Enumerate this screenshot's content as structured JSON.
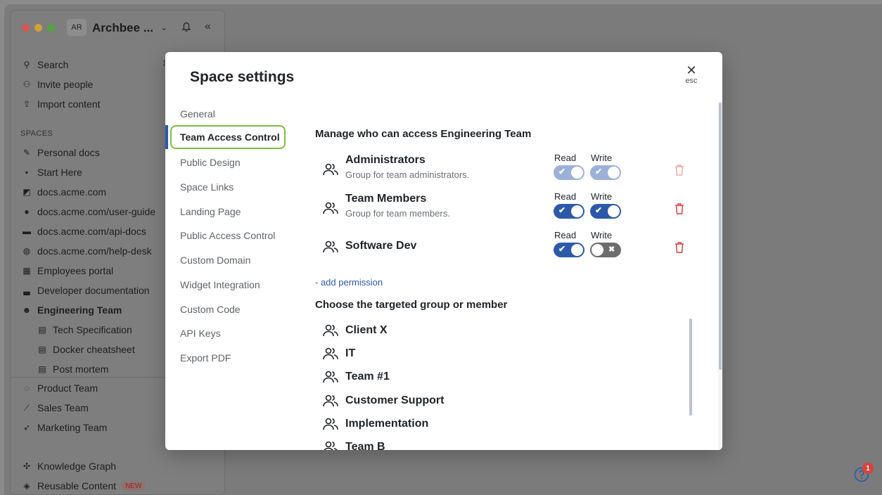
{
  "workspace": {
    "avatar": "AR",
    "name": "Archbee ...",
    "shortcut": "⌘K"
  },
  "sidebar": {
    "top_items": [
      {
        "label": "Search",
        "icon": "search-icon"
      },
      {
        "label": "Invite people",
        "icon": "invite-icon"
      },
      {
        "label": "Import content",
        "icon": "upload-icon"
      }
    ],
    "section_label": "SPACES",
    "spaces": [
      {
        "label": "Personal docs",
        "icon": "pencil-icon"
      },
      {
        "label": "Start Here",
        "icon": "new-icon"
      },
      {
        "label": "docs.acme.com",
        "icon": "book-icon"
      },
      {
        "label": "docs.acme.com/user-guide",
        "icon": "user-icon"
      },
      {
        "label": "docs.acme.com/api-docs",
        "icon": "ruler-icon"
      },
      {
        "label": "docs.acme.com/help-desk",
        "icon": "globe-icon"
      },
      {
        "label": "Employees portal",
        "icon": "building-icon"
      },
      {
        "label": "Developer documentation",
        "icon": "laptop-icon"
      },
      {
        "label": "Engineering Team",
        "icon": "engineer-icon"
      }
    ],
    "sub_pages": [
      {
        "label": "Tech Specification",
        "icon": "page-icon"
      },
      {
        "label": "Docker cheatsheet",
        "icon": "page-icon"
      },
      {
        "label": "Post mortem",
        "icon": "page-icon"
      }
    ],
    "more_spaces": [
      {
        "label": "Product Team",
        "icon": "chat-icon"
      },
      {
        "label": "Sales Team",
        "icon": "chart-icon"
      },
      {
        "label": "Marketing Team",
        "icon": "rocket-icon"
      }
    ],
    "bottom_items": [
      {
        "label": "Knowledge Graph",
        "icon": "graph-icon"
      },
      {
        "label": "Reusable Content",
        "icon": "cube-icon",
        "badge": "NEW"
      }
    ]
  },
  "modal": {
    "title": "Space settings",
    "close_label": "esc",
    "tabs": [
      "General",
      "Team Access Control",
      "Public Design",
      "Space Links",
      "Landing Page",
      "Public Access Control",
      "Custom Domain",
      "Widget Integration",
      "Custom Code",
      "API Keys",
      "Export PDF"
    ],
    "active_tab": "Team Access Control",
    "manage_heading": "Manage who can access Engineering Team",
    "read_label": "Read",
    "write_label": "Write",
    "permissions": [
      {
        "name": "Administrators",
        "description": "Group for team administrators.",
        "read": true,
        "write": true,
        "locked": true
      },
      {
        "name": "Team Members",
        "description": "Group for team members.",
        "read": true,
        "write": true,
        "locked": false
      },
      {
        "name": "Software Dev",
        "description": "",
        "read": true,
        "write": false,
        "locked": false
      }
    ],
    "add_permission": "- add permission",
    "choose_heading": "Choose the targeted group or member",
    "groups": [
      "Client X",
      "IT",
      "Team #1",
      "Customer Support",
      "Implementation",
      "Team B"
    ]
  },
  "help": {
    "notification_count": "1"
  },
  "colors": {
    "accent": "#2c5aa8",
    "active_outline": "#7cbf3f",
    "danger": "#d9423a"
  }
}
